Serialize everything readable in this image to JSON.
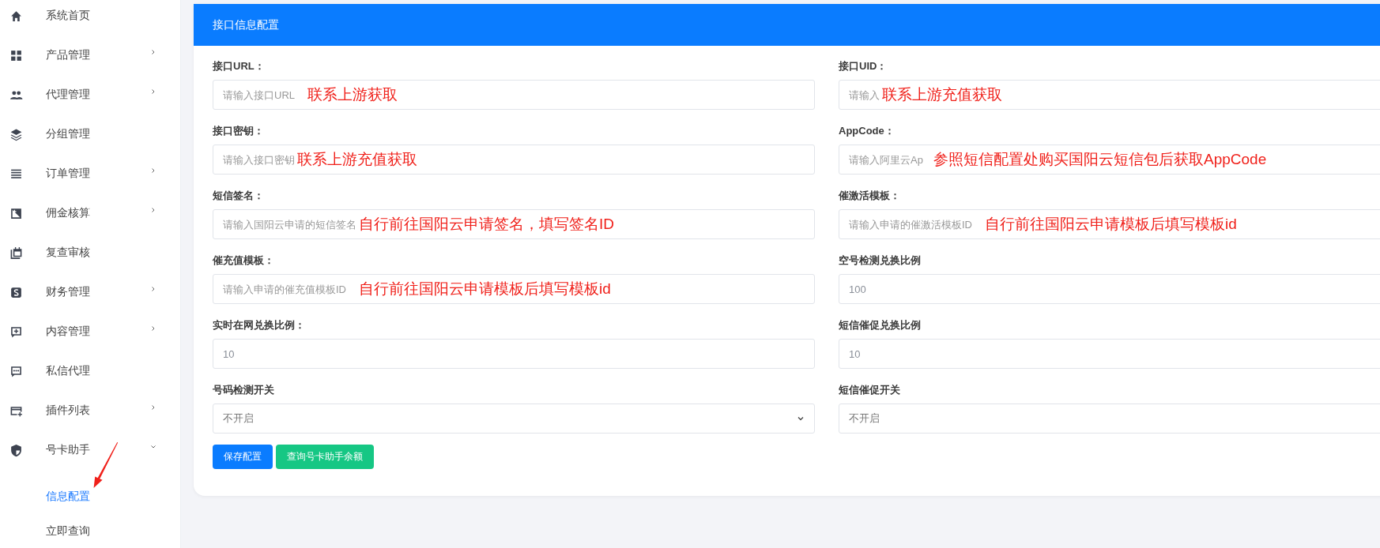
{
  "sidebar": {
    "items": [
      {
        "label": "系统首页",
        "expandable": false,
        "selected": false
      },
      {
        "label": "产品管理",
        "expandable": true,
        "expanded": false,
        "selected": false
      },
      {
        "label": "代理管理",
        "expandable": true,
        "expanded": false,
        "selected": false
      },
      {
        "label": "分组管理",
        "expandable": false,
        "selected": false
      },
      {
        "label": "订单管理",
        "expandable": true,
        "expanded": false,
        "selected": false
      },
      {
        "label": "佣金核算",
        "expandable": true,
        "expanded": false,
        "selected": false
      },
      {
        "label": "复查审核",
        "expandable": false,
        "selected": false
      },
      {
        "label": "财务管理",
        "expandable": true,
        "expanded": false,
        "selected": false
      },
      {
        "label": "内容管理",
        "expandable": true,
        "expanded": false,
        "selected": false
      },
      {
        "label": "私信代理",
        "expandable": false,
        "selected": false
      },
      {
        "label": "插件列表",
        "expandable": true,
        "expanded": false,
        "selected": false
      },
      {
        "label": "号卡助手",
        "expandable": true,
        "expanded": true,
        "selected": false,
        "children": [
          {
            "label": "信息配置",
            "selected": true
          },
          {
            "label": "立即查询",
            "selected": false
          }
        ]
      }
    ]
  },
  "card": {
    "title": "接口信息配置",
    "fields": [
      {
        "kind": "input",
        "label": "接口URL：",
        "placeholder": "请输入接口URL",
        "annotation": "联系上游获取"
      },
      {
        "kind": "input",
        "label": "接口UID：",
        "placeholder": "请输入",
        "annotation": "联系上游充值获取"
      },
      {
        "kind": "input",
        "label": "接口密钥：",
        "placeholder": "请输入接口密钥",
        "annotation": "联系上游充值获取"
      },
      {
        "kind": "input",
        "label": "AppCode：",
        "placeholder": "请输入阿里云Ap",
        "annotation": "参照短信配置处购买国阳云短信包后获取AppCode"
      },
      {
        "kind": "input",
        "label": "短信签名：",
        "placeholder": "请输入国阳云申请的短信签名",
        "annotation": "自行前往国阳云申请签名，填写签名ID"
      },
      {
        "kind": "input",
        "label": "催激活模板：",
        "placeholder": "请输入申请的催激活模板ID",
        "annotation": "自行前往国阳云申请模板后填写模板id"
      },
      {
        "kind": "input",
        "label": "催充值模板：",
        "placeholder": "请输入申请的催充值模板ID",
        "annotation": "自行前往国阳云申请模板后填写模板id"
      },
      {
        "kind": "input",
        "label": "空号检测兑换比例",
        "value": "100"
      },
      {
        "kind": "input",
        "label": "实时在网兑换比例：",
        "value": "10"
      },
      {
        "kind": "input",
        "label": "短信催促兑换比例",
        "value": "10"
      },
      {
        "kind": "select",
        "label": "号码检测开关",
        "value": "不开启"
      },
      {
        "kind": "select",
        "label": "短信催促开关",
        "value": "不开启"
      }
    ],
    "buttons": [
      {
        "label": "保存配置",
        "kind": "primary"
      },
      {
        "label": "查询号卡助手余额",
        "kind": "success"
      }
    ]
  }
}
